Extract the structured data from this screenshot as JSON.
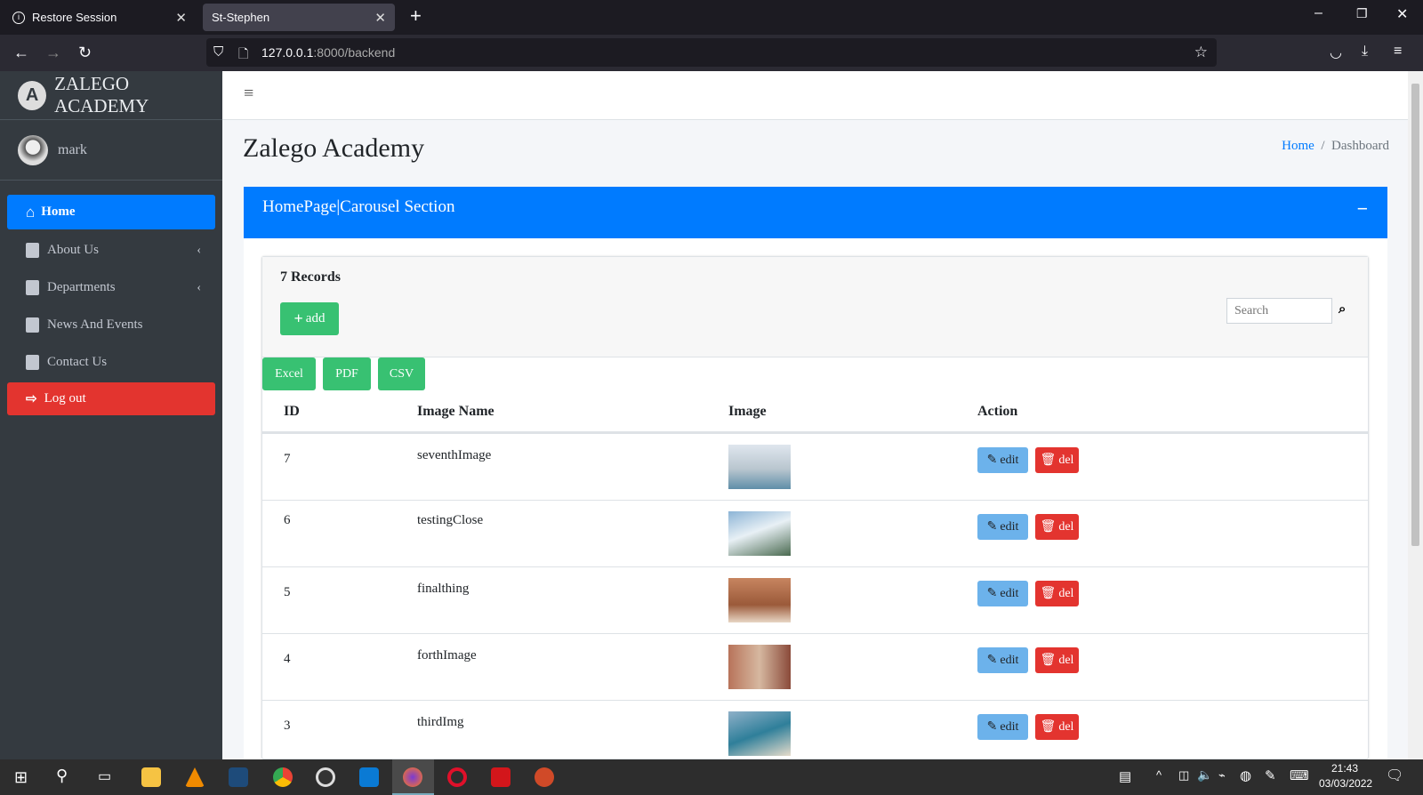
{
  "browser": {
    "tabs": [
      {
        "label": "Restore Session",
        "icon": "info-icon"
      },
      {
        "label": "St-Stephen"
      }
    ],
    "url_host": "127.0.0.1",
    "url_rest": ":8000/backend"
  },
  "sidebar": {
    "brand": "ZALEGO ACADEMY",
    "user": "mark",
    "items": [
      {
        "label": "Home",
        "active": true
      },
      {
        "label": "About Us",
        "submenu": true
      },
      {
        "label": "Departments",
        "submenu": true
      },
      {
        "label": "News And Events"
      },
      {
        "label": "Contact Us"
      },
      {
        "label": "Log out"
      }
    ]
  },
  "page": {
    "title": "Zalego Academy",
    "breadcrumb": [
      "Home",
      "Dashboard"
    ],
    "card_title": "HomePage|Carousel Section",
    "records": "7 Records",
    "add_label": "add",
    "search_placeholder": "Search",
    "exports": [
      "Excel",
      "PDF",
      "CSV"
    ]
  },
  "table": {
    "headers": [
      "ID",
      "Image Name",
      "Image",
      "Action"
    ],
    "rows": [
      {
        "id": "7",
        "name": "seventhImage",
        "edit": "edit",
        "del": "del",
        "img": "linear-gradient(#dfe6ee,#b9c6cf 55%,#5f8ea8)"
      },
      {
        "id": "6",
        "name": "testingClose",
        "edit": "edit",
        "del": "del",
        "img": "linear-gradient(160deg,#8cb4d6,#e8f0f5 45%,#4a6a50)"
      },
      {
        "id": "5",
        "name": "finalthing",
        "edit": "edit",
        "del": "del",
        "img": "linear-gradient(#c78560,#9b5a3a 60%,#e8d6c4)"
      },
      {
        "id": "4",
        "name": "forthImage",
        "edit": "edit",
        "del": "del",
        "img": "linear-gradient(90deg,#b8735a,#d6b8a0 50%,#8a4a3a)"
      },
      {
        "id": "3",
        "name": "thirdImg",
        "edit": "edit",
        "del": "del",
        "img": "linear-gradient(160deg,#8fb0c8,#2f7f9a 50%,#e6dccb)"
      }
    ]
  },
  "colors": {
    "primary": "#007bff",
    "success": "#38c172",
    "danger": "#e3342f",
    "info": "#6cb2eb",
    "sidebar": "#343a40"
  },
  "taskbar": {
    "time": "21:43",
    "date": "03/03/2022"
  }
}
